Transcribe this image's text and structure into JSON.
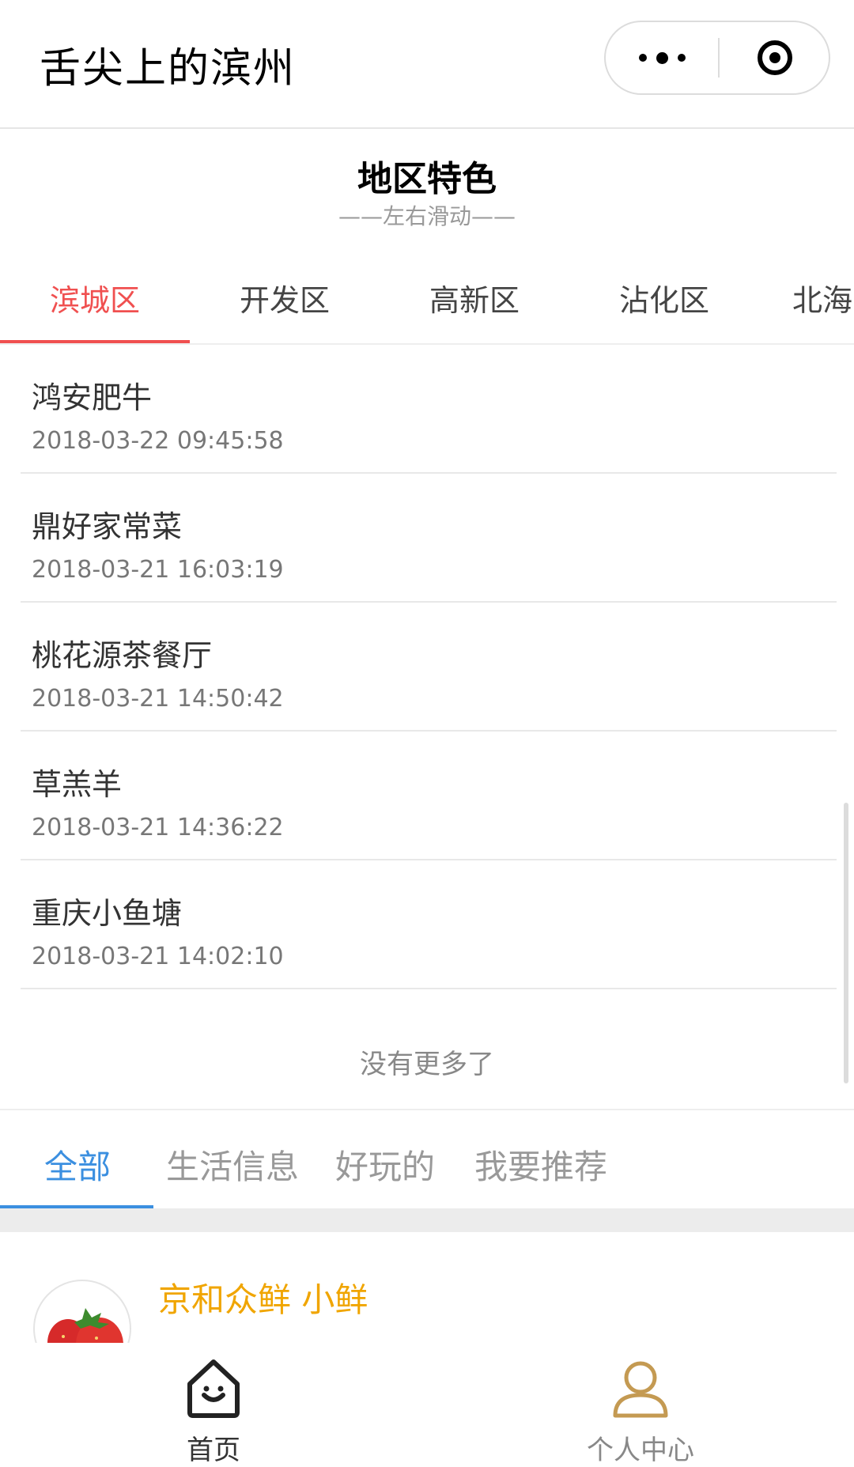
{
  "navbar": {
    "title": "舌尖上的滨州",
    "more_icon": "more-dots-icon",
    "close_icon": "target-close-icon"
  },
  "section": {
    "title": "地区特色",
    "subtitle": "——左右滑动——"
  },
  "district_tabs": [
    {
      "label": "滨城区",
      "active": true
    },
    {
      "label": "开发区",
      "active": false
    },
    {
      "label": "高新区",
      "active": false
    },
    {
      "label": "沾化区",
      "active": false
    },
    {
      "label": "北海",
      "active": false
    }
  ],
  "list": [
    {
      "name": "鸿安肥牛",
      "time": "2018-03-22 09:45:58"
    },
    {
      "name": "鼎好家常菜",
      "time": "2018-03-21 16:03:19"
    },
    {
      "name": "桃花源茶餐厅",
      "time": "2018-03-21 14:50:42"
    },
    {
      "name": "草羔羊",
      "time": "2018-03-21 14:36:22"
    },
    {
      "name": "重庆小鱼塘",
      "time": "2018-03-21 14:02:10"
    }
  ],
  "no_more": "没有更多了",
  "category_tabs": [
    {
      "label": "全部",
      "active": true
    },
    {
      "label": "生活信息",
      "active": false
    },
    {
      "label": "好玩的",
      "active": false
    },
    {
      "label": "我要推荐",
      "active": false
    }
  ],
  "post": {
    "author": "京和众鲜 小鲜"
  },
  "tabbar": {
    "home": {
      "label": "首页",
      "icon": "home-icon"
    },
    "me": {
      "label": "个人中心",
      "icon": "user-icon"
    }
  },
  "colors": {
    "district_active": "#f05050",
    "category_active": "#3b8fe0",
    "author": "#f0a500",
    "user_icon": "#c49a52"
  }
}
